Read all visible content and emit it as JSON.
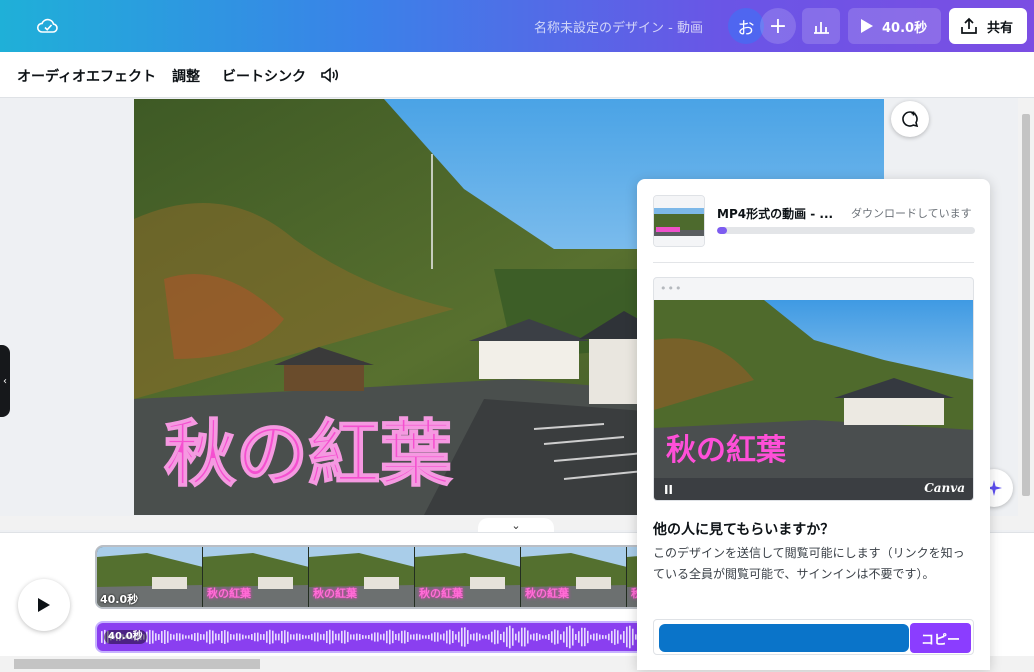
{
  "header": {
    "doc_title": "名称未設定のデザイン - 動画",
    "avatar_initial": "お",
    "plus_label": "+",
    "play_time_label": "40.0秒",
    "share_label": "共有"
  },
  "toolbar": {
    "items": [
      "オーディオエフェクト",
      "調整",
      "ビートシンク"
    ]
  },
  "canvas": {
    "overlay_text": "秋の紅葉",
    "overlay_color": "#ff4fd8"
  },
  "timeline": {
    "collapse_icon": "⌄",
    "video_duration": "40.0秒",
    "audio_duration": "40.0秒",
    "frame_caption": "秋の紅葉",
    "frame_count": 6
  },
  "share_panel": {
    "download_title": "MP4形式の動画 - ...",
    "download_status": "ダウンロードしています",
    "download_progress_fraction": 0.04,
    "preview_dots": "•••",
    "preview_caption": "秋の紅葉",
    "preview_pause": "II",
    "preview_brand": "Canva",
    "question": "他の人に見てもらいますか？",
    "description": "このデザインを送信して閲覧可能にします（リンクを知っている全員が閲覧可能で、サインインは不要です）。",
    "copy_label": "コピー"
  },
  "colors": {
    "accent": "#8b3dff",
    "link_field": "#0a74c9"
  }
}
